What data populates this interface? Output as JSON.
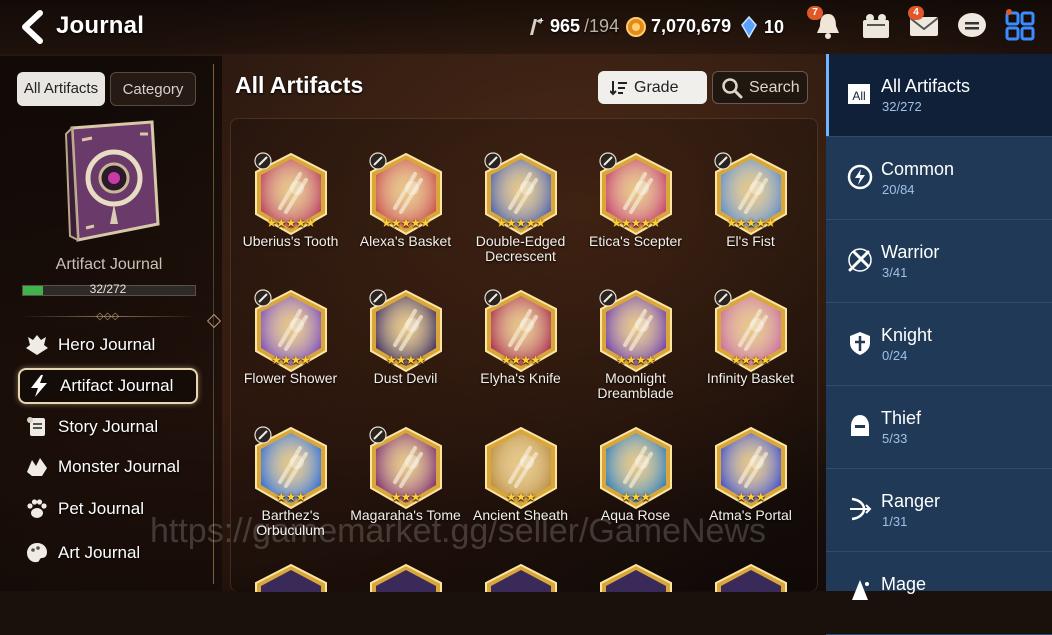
{
  "header": {
    "title": "Journal",
    "stamina_value": "965",
    "stamina_max": "/194",
    "gold": "7,070,679",
    "crystals": "10",
    "notify_badge": "7",
    "mail_badge": "4"
  },
  "left": {
    "tab_all": "All Artifacts",
    "tab_category": "Category",
    "book_label": "Artifact Journal",
    "progress_text": "32/272",
    "progress_fraction": 0.118,
    "nav": [
      {
        "label": "Hero Journal"
      },
      {
        "label": "Artifact Journal"
      },
      {
        "label": "Story Journal"
      },
      {
        "label": "Monster Journal"
      },
      {
        "label": "Pet Journal"
      },
      {
        "label": "Art Journal"
      }
    ]
  },
  "main": {
    "title": "All Artifacts",
    "grade_label": "Grade",
    "search_label": "Search",
    "items": [
      {
        "name": "Uberius's Tooth",
        "stars": "★★★★★",
        "color": "#b83a5a"
      },
      {
        "name": "Alexa's Basket",
        "stars": "★★★★★",
        "color": "#c84a4a"
      },
      {
        "name": "Double-Edged Decrescent",
        "stars": "★★★★★",
        "color": "#4a5ea8"
      },
      {
        "name": "Etica's Scepter",
        "stars": "★★★★★",
        "color": "#c43a6a"
      },
      {
        "name": "El's Fist",
        "stars": "★★★★★",
        "color": "#5a8ac8"
      },
      {
        "name": "Flower Shower",
        "stars": "★★★★",
        "color": "#7a4ab8"
      },
      {
        "name": "Dust Devil",
        "stars": "★★★★",
        "color": "#3a2a5a"
      },
      {
        "name": "Elyha's Knife",
        "stars": "★★★★",
        "color": "#a82a4a"
      },
      {
        "name": "Moonlight Dreamblade",
        "stars": "★★★★",
        "color": "#6a3aa8"
      },
      {
        "name": "Infinity Basket",
        "stars": "★★★★",
        "color": "#c86a9a"
      },
      {
        "name": "Barthez's Orbuculum",
        "stars": "★★★",
        "color": "#2a6ad8"
      },
      {
        "name": "Magaraha's Tome",
        "stars": "★★★",
        "color": "#7a2a6a"
      },
      {
        "name": "Ancient Sheath",
        "stars": "★★★",
        "color": "#b88a3a"
      },
      {
        "name": "Aqua Rose",
        "stars": "★★★",
        "color": "#2a7ab8"
      },
      {
        "name": "Atma's Portal",
        "stars": "★★★",
        "color": "#3a4ac8"
      }
    ]
  },
  "right": {
    "items": [
      {
        "label": "All Artifacts",
        "count": "32/272",
        "icon": "all-icon",
        "icon_text": "All"
      },
      {
        "label": "Common",
        "count": "20/84",
        "icon": "common-icon"
      },
      {
        "label": "Warrior",
        "count": "3/41",
        "icon": "warrior-icon"
      },
      {
        "label": "Knight",
        "count": "0/24",
        "icon": "knight-icon"
      },
      {
        "label": "Thief",
        "count": "5/33",
        "icon": "thief-icon"
      },
      {
        "label": "Ranger",
        "count": "1/31",
        "icon": "ranger-icon"
      },
      {
        "label": "Mage",
        "count": "",
        "icon": "mage-icon"
      }
    ]
  },
  "watermark": "https://gamemarket.gg/seller/GameNews"
}
